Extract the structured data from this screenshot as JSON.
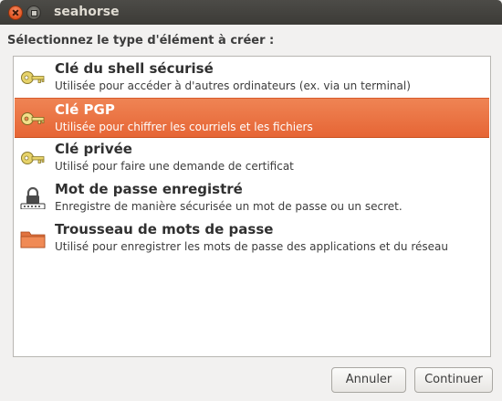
{
  "window": {
    "title": "seahorse"
  },
  "prompt": "Sélectionnez le type d'élément à créer :",
  "items": [
    {
      "title": "Clé du shell sécurisé",
      "description": "Utilisée pour accéder à d'autres ordinateurs (ex. via un terminal)",
      "icon": "key-icon",
      "selected": false
    },
    {
      "title": "Clé PGP",
      "description": "Utilisée pour chiffrer les courriels et les fichiers",
      "icon": "key-icon",
      "selected": true
    },
    {
      "title": "Clé privée",
      "description": "Utilisé pour faire une demande de certificat",
      "icon": "key-icon",
      "selected": false
    },
    {
      "title": "Mot de passe enregistré",
      "description": "Enregistre de manière sécurisée un mot de passe ou un secret.",
      "icon": "lock-icon",
      "selected": false
    },
    {
      "title": "Trousseau de mots de passe",
      "description": "Utilisé pour enregistrer les mots de passe des applications et du réseau",
      "icon": "folder-icon",
      "selected": false
    }
  ],
  "buttons": {
    "cancel": "Annuler",
    "continue": "Continuer"
  },
  "colors": {
    "selection": "#e9703e",
    "titlebar": "#3c3b37"
  }
}
